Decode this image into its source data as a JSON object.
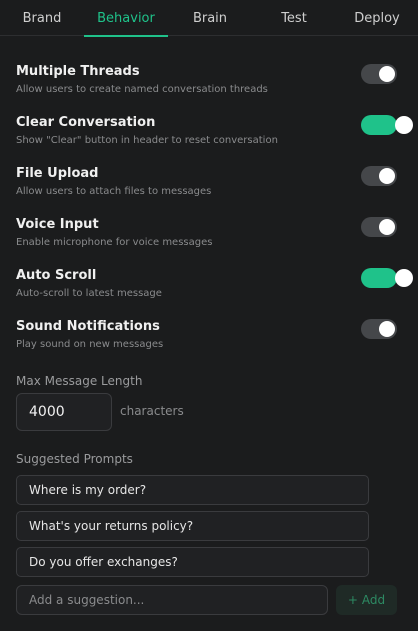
{
  "tabs": [
    {
      "label": "Brand",
      "active": false
    },
    {
      "label": "Behavior",
      "active": true
    },
    {
      "label": "Brain",
      "active": false
    },
    {
      "label": "Test",
      "active": false
    },
    {
      "label": "Deploy",
      "active": false
    }
  ],
  "settings": [
    {
      "label": "Multiple Threads",
      "description": "Allow users to create named conversation threads",
      "enabled": false
    },
    {
      "label": "Clear Conversation",
      "description": "Show \"Clear\" button in header to reset conversation",
      "enabled": true
    },
    {
      "label": "File Upload",
      "description": "Allow users to attach files to messages",
      "enabled": false
    },
    {
      "label": "Voice Input",
      "description": "Enable microphone for voice messages",
      "enabled": false
    },
    {
      "label": "Auto Scroll",
      "description": "Auto-scroll to latest message",
      "enabled": true
    },
    {
      "label": "Sound Notifications",
      "description": "Play sound on new messages",
      "enabled": false
    }
  ],
  "max_length": {
    "label": "Max Message Length",
    "value": "4000",
    "unit": "characters"
  },
  "suggested_prompts": {
    "label": "Suggested Prompts",
    "items": [
      "Where is my order?",
      "What's your returns policy?",
      "Do you offer exchanges?"
    ],
    "add_placeholder": "Add a suggestion...",
    "add_button_label": "Add",
    "add_icon": "plus-icon"
  },
  "colors": {
    "accent": "#1fc28a",
    "background": "#1b1c1d",
    "toggle_off": "#45474a"
  }
}
